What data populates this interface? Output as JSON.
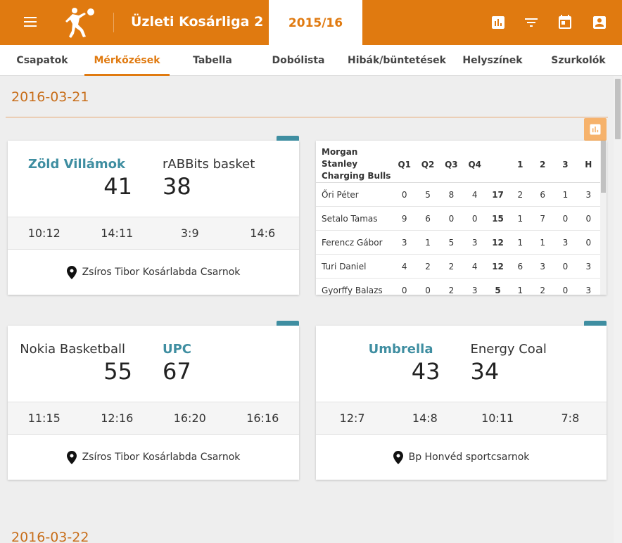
{
  "app": {
    "title": "Üzleti Kosárliga 2",
    "season": "2015/16",
    "accent": "#e07a10",
    "team_accent": "#3f8ea1"
  },
  "topbar_icons": [
    "bar-chart-icon",
    "filter-icon",
    "calendar-icon",
    "account-box-icon"
  ],
  "nav": {
    "tabs": [
      {
        "label": "Csapatok"
      },
      {
        "label": "Mérkőzések"
      },
      {
        "label": "Tabella"
      },
      {
        "label": "Dobólista"
      },
      {
        "label": "Hibák/büntetések"
      },
      {
        "label": "Helyszínek"
      },
      {
        "label": "Szurkolók"
      }
    ],
    "active": "Mérkőzések"
  },
  "days": [
    {
      "date": "2016-03-21"
    },
    {
      "date": "2016-03-22"
    }
  ],
  "games": [
    {
      "home": "Zöld Villámok",
      "away": "rABBits basket",
      "home_score": "41",
      "away_score": "38",
      "winner": "home",
      "quarters": [
        "10:12",
        "14:11",
        "3:9",
        "14:6"
      ],
      "venue": "Zsíros Tibor Kosárlabda Csarnok"
    },
    {
      "home": "Nokia Basketball",
      "away": "UPC",
      "home_score": "55",
      "away_score": "67",
      "winner": "away",
      "quarters": [
        "11:15",
        "12:16",
        "16:20",
        "16:16"
      ],
      "venue": "Zsíros Tibor Kosárlabda Csarnok"
    },
    {
      "home": "Umbrella",
      "away": "Energy Coal",
      "home_score": "43",
      "away_score": "34",
      "winner": "home",
      "quarters": [
        "12:7",
        "14:8",
        "10:11",
        "7:8"
      ],
      "venue": "Bp Honvéd sportcsarnok"
    }
  ],
  "stats": {
    "team_line1": "Morgan Stanley",
    "team_line2": "Charging Bulls",
    "headers": [
      "Q1",
      "Q2",
      "Q3",
      "Q4",
      "",
      "1",
      "2",
      "3",
      "H"
    ],
    "rows": [
      {
        "name": "Őri Péter",
        "q": [
          "0",
          "5",
          "8",
          "4"
        ],
        "pts": "17",
        "s": [
          "2",
          "6",
          "1",
          "3"
        ]
      },
      {
        "name": "Setalo Tamas",
        "q": [
          "9",
          "6",
          "0",
          "0"
        ],
        "pts": "15",
        "s": [
          "1",
          "7",
          "0",
          "0"
        ]
      },
      {
        "name": "Ferencz Gábor",
        "q": [
          "3",
          "1",
          "5",
          "3"
        ],
        "pts": "12",
        "s": [
          "1",
          "1",
          "3",
          "0"
        ]
      },
      {
        "name": "Turi Daniel",
        "q": [
          "4",
          "2",
          "2",
          "4"
        ],
        "pts": "12",
        "s": [
          "6",
          "3",
          "0",
          "3"
        ]
      },
      {
        "name": "Gyorffy Balazs",
        "q": [
          "0",
          "0",
          "2",
          "3"
        ],
        "pts": "5",
        "s": [
          "1",
          "2",
          "0",
          "3"
        ]
      }
    ]
  }
}
